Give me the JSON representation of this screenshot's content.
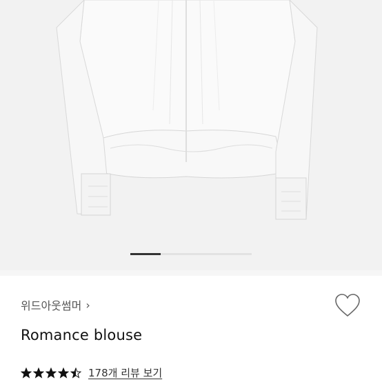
{
  "product": {
    "brand": "위드아웃썸머",
    "brand_chevron": "›",
    "title": "Romance blouse",
    "rating": 4.5,
    "rating_max": 5,
    "review_link": "178개 리뷰 보기"
  },
  "gallery": {
    "current_index": 1,
    "progress_fraction": 0.25
  },
  "icons": {
    "wishlist": "heart-outline-icon",
    "star": "star-icon"
  },
  "colors": {
    "star": "#111111",
    "pager_active": "#333333"
  }
}
